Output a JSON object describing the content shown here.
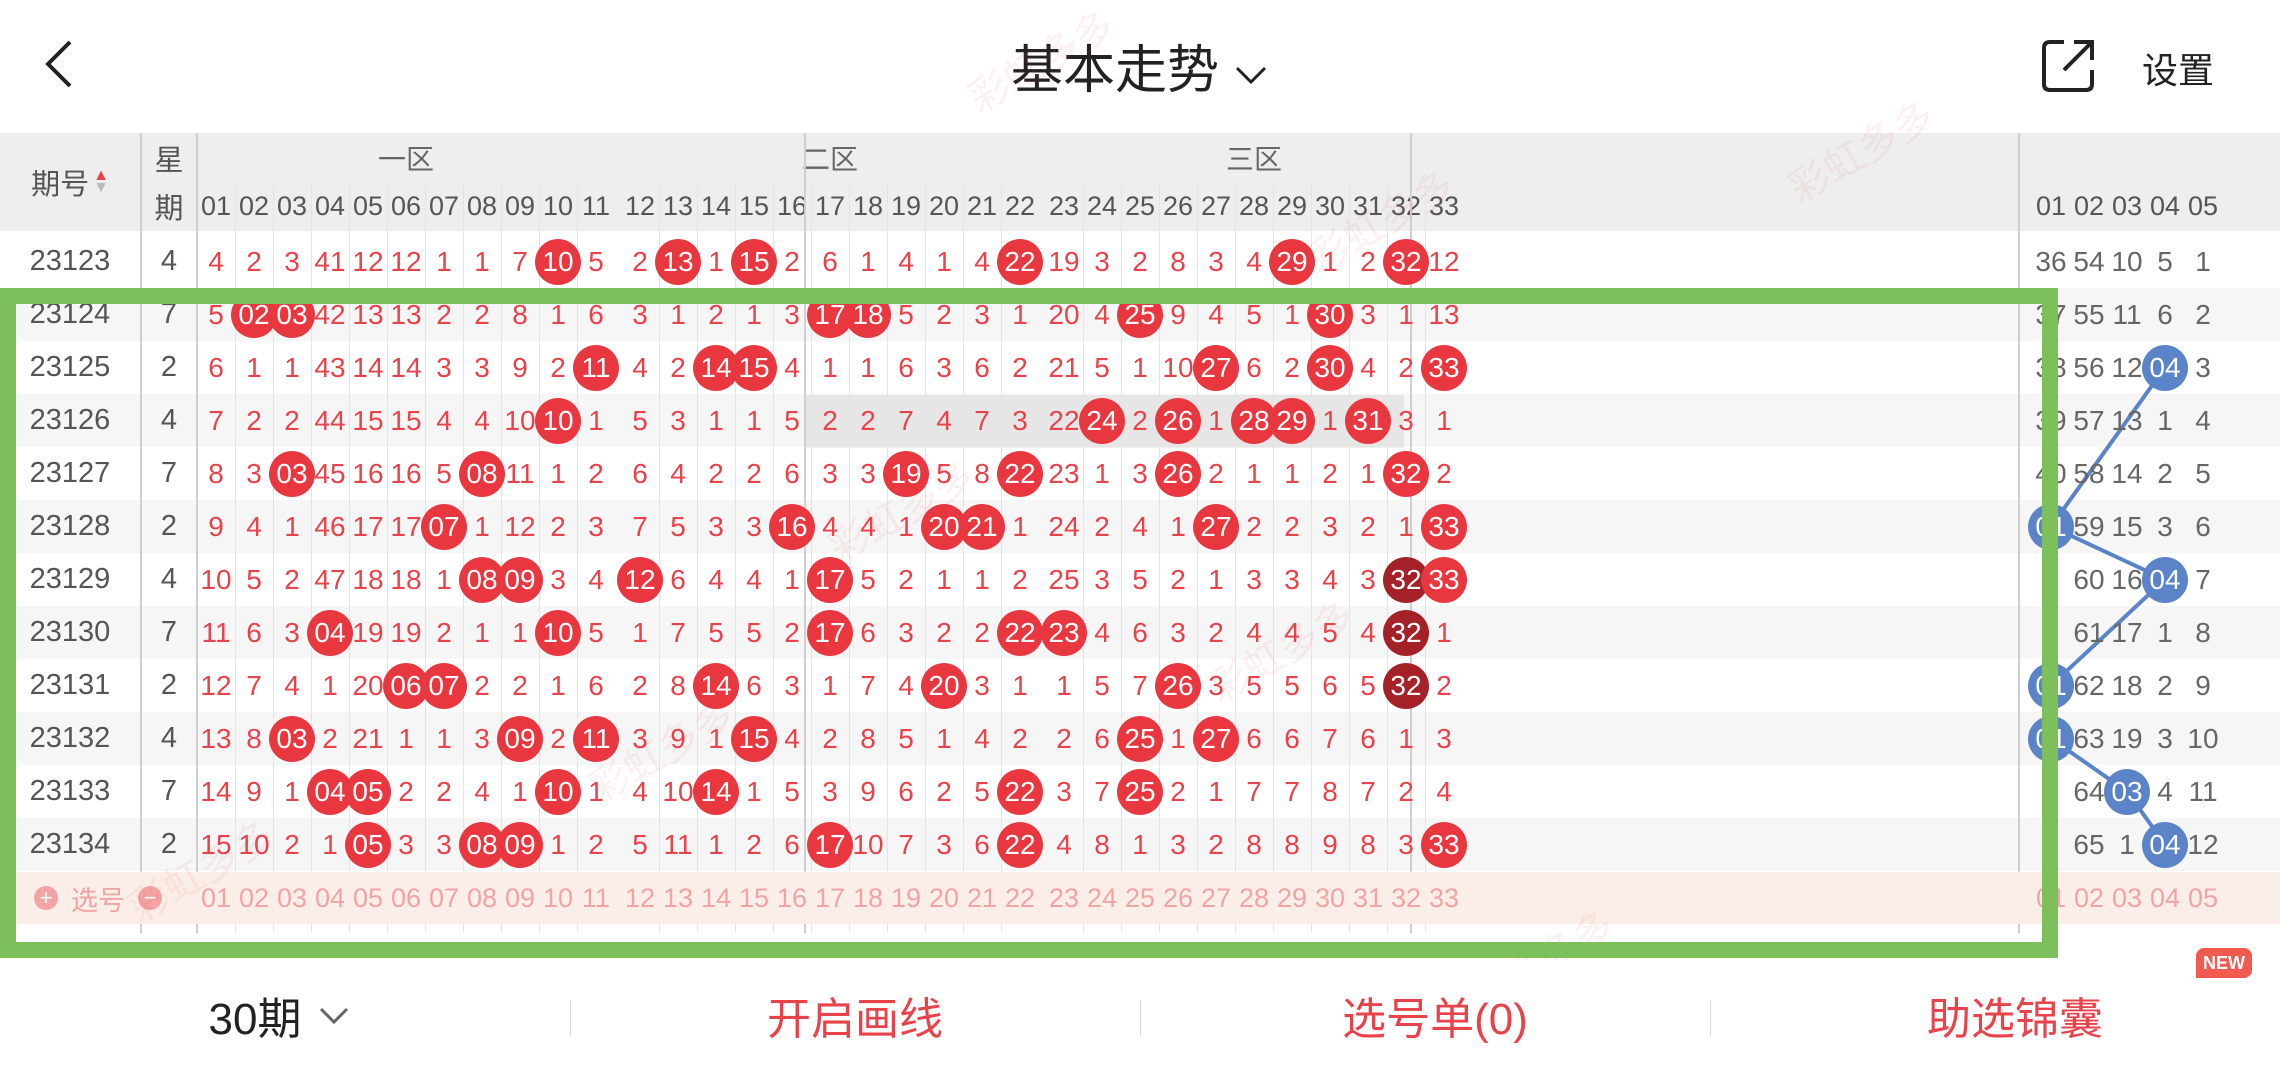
{
  "header": {
    "title": "基本走势",
    "settings_label": "设置"
  },
  "table": {
    "issue_header": "期号",
    "week_header_1": "星",
    "week_header_2": "期",
    "zones": [
      "一区",
      "二区",
      "三区"
    ],
    "front_numbers": [
      "01",
      "02",
      "03",
      "04",
      "05",
      "06",
      "07",
      "08",
      "09",
      "10",
      "11",
      "12",
      "13",
      "14",
      "15",
      "16",
      "17",
      "18",
      "19",
      "20",
      "21",
      "22",
      "23",
      "24",
      "25",
      "26",
      "27",
      "28",
      "29",
      "30",
      "31",
      "32",
      "33"
    ],
    "back_numbers": [
      "01",
      "02",
      "03",
      "04",
      "05"
    ],
    "rows": [
      {
        "issue": "23123",
        "week": "4",
        "cells": [
          "4",
          "2",
          "3",
          "41",
          "12",
          "12",
          "1",
          "1",
          "7",
          "10",
          "5",
          "2",
          "13",
          "1",
          "15",
          "2",
          "6",
          "1",
          "4",
          "1",
          "4",
          "22",
          "19",
          "3",
          "2",
          "8",
          "3",
          "4",
          "29",
          "1",
          "2",
          "32",
          "12"
        ],
        "balls": [
          9,
          12,
          14,
          21,
          28,
          31
        ],
        "back": [
          "36",
          "54",
          "10",
          "5",
          "1"
        ],
        "back_ball": null
      },
      {
        "issue": "23124",
        "week": "7",
        "cells": [
          "5",
          "02",
          "03",
          "42",
          "13",
          "13",
          "2",
          "2",
          "8",
          "1",
          "6",
          "3",
          "1",
          "2",
          "1",
          "3",
          "17",
          "18",
          "5",
          "2",
          "3",
          "1",
          "20",
          "4",
          "25",
          "9",
          "4",
          "5",
          "1",
          "30",
          "3",
          "1",
          "13"
        ],
        "balls": [
          1,
          2,
          16,
          17,
          24,
          29
        ],
        "back": [
          "37",
          "55",
          "11",
          "6",
          "2"
        ],
        "back_ball": null
      },
      {
        "issue": "23125",
        "week": "2",
        "cells": [
          "6",
          "1",
          "1",
          "43",
          "14",
          "14",
          "3",
          "3",
          "9",
          "2",
          "11",
          "4",
          "2",
          "14",
          "15",
          "4",
          "1",
          "1",
          "6",
          "3",
          "6",
          "2",
          "21",
          "5",
          "1",
          "10",
          "27",
          "6",
          "2",
          "30",
          "4",
          "2",
          "33"
        ],
        "balls": [
          10,
          13,
          14,
          26,
          29,
          32
        ],
        "back": [
          "38",
          "56",
          "12",
          "04",
          "3"
        ],
        "back_ball": 3
      },
      {
        "issue": "23126",
        "week": "4",
        "cells": [
          "7",
          "2",
          "2",
          "44",
          "15",
          "15",
          "4",
          "4",
          "10",
          "10",
          "1",
          "5",
          "3",
          "1",
          "1",
          "5",
          "2",
          "2",
          "7",
          "4",
          "7",
          "3",
          "22",
          "24",
          "2",
          "26",
          "1",
          "28",
          "29",
          "1",
          "31",
          "3",
          "1"
        ],
        "balls": [
          9,
          23,
          25,
          27,
          28,
          30
        ],
        "back": [
          "39",
          "57",
          "13",
          "1",
          "4"
        ],
        "back_ball": null
      },
      {
        "issue": "23127",
        "week": "7",
        "cells": [
          "8",
          "3",
          "03",
          "45",
          "16",
          "16",
          "5",
          "08",
          "11",
          "1",
          "2",
          "6",
          "4",
          "2",
          "2",
          "6",
          "3",
          "3",
          "19",
          "5",
          "8",
          "22",
          "23",
          "1",
          "3",
          "26",
          "2",
          "1",
          "1",
          "2",
          "1",
          "32",
          "2"
        ],
        "balls": [
          2,
          7,
          18,
          21,
          25,
          31
        ],
        "back": [
          "40",
          "58",
          "14",
          "2",
          "5"
        ],
        "back_ball": null
      },
      {
        "issue": "23128",
        "week": "2",
        "cells": [
          "9",
          "4",
          "1",
          "46",
          "17",
          "17",
          "07",
          "1",
          "12",
          "2",
          "3",
          "7",
          "5",
          "3",
          "3",
          "16",
          "4",
          "4",
          "1",
          "20",
          "21",
          "1",
          "24",
          "2",
          "4",
          "1",
          "27",
          "2",
          "2",
          "3",
          "2",
          "1",
          "33"
        ],
        "balls": [
          6,
          15,
          19,
          20,
          26,
          32
        ],
        "back": [
          "01",
          "59",
          "15",
          "3",
          "6"
        ],
        "back_ball": 0
      },
      {
        "issue": "23129",
        "week": "4",
        "cells": [
          "10",
          "5",
          "2",
          "47",
          "18",
          "18",
          "1",
          "08",
          "09",
          "3",
          "4",
          "12",
          "6",
          "4",
          "4",
          "1",
          "17",
          "5",
          "2",
          "1",
          "1",
          "2",
          "25",
          "3",
          "5",
          "2",
          "1",
          "3",
          "3",
          "4",
          "3",
          "32",
          "33"
        ],
        "balls": [
          7,
          8,
          11,
          16,
          31,
          32
        ],
        "back": [
          "1",
          "60",
          "16",
          "04",
          "7"
        ],
        "back_ball": 3,
        "dark": [
          31
        ]
      },
      {
        "issue": "23130",
        "week": "7",
        "cells": [
          "11",
          "6",
          "3",
          "04",
          "19",
          "19",
          "2",
          "1",
          "1",
          "10",
          "5",
          "1",
          "7",
          "5",
          "5",
          "2",
          "17",
          "6",
          "3",
          "2",
          "2",
          "22",
          "23",
          "4",
          "6",
          "3",
          "2",
          "4",
          "4",
          "5",
          "4",
          "32",
          "1"
        ],
        "balls": [
          3,
          9,
          16,
          21,
          22,
          31
        ],
        "back": [
          "2",
          "61",
          "17",
          "1",
          "8"
        ],
        "back_ball": null,
        "dark": [
          31
        ]
      },
      {
        "issue": "23131",
        "week": "2",
        "cells": [
          "12",
          "7",
          "4",
          "1",
          "20",
          "06",
          "07",
          "2",
          "2",
          "1",
          "6",
          "2",
          "8",
          "14",
          "6",
          "3",
          "1",
          "7",
          "4",
          "20",
          "3",
          "1",
          "1",
          "5",
          "7",
          "26",
          "3",
          "5",
          "5",
          "6",
          "5",
          "32",
          "2"
        ],
        "balls": [
          5,
          6,
          13,
          19,
          25,
          31
        ],
        "back": [
          "01",
          "62",
          "18",
          "2",
          "9"
        ],
        "back_ball": 0,
        "dark": [
          31
        ]
      },
      {
        "issue": "23132",
        "week": "4",
        "cells": [
          "13",
          "8",
          "03",
          "2",
          "21",
          "1",
          "1",
          "3",
          "09",
          "2",
          "11",
          "3",
          "9",
          "1",
          "15",
          "4",
          "2",
          "8",
          "5",
          "1",
          "4",
          "2",
          "2",
          "6",
          "25",
          "1",
          "27",
          "6",
          "6",
          "7",
          "6",
          "1",
          "3"
        ],
        "balls": [
          2,
          8,
          10,
          14,
          24,
          26
        ],
        "back": [
          "01",
          "63",
          "19",
          "3",
          "10"
        ],
        "back_ball": 0
      },
      {
        "issue": "23133",
        "week": "7",
        "cells": [
          "14",
          "9",
          "1",
          "04",
          "05",
          "2",
          "2",
          "4",
          "1",
          "10",
          "1",
          "4",
          "10",
          "14",
          "1",
          "5",
          "3",
          "9",
          "6",
          "2",
          "5",
          "22",
          "3",
          "7",
          "25",
          "2",
          "1",
          "7",
          "7",
          "8",
          "7",
          "2",
          "4"
        ],
        "balls": [
          3,
          4,
          9,
          13,
          21,
          24
        ],
        "back": [
          "2",
          "64",
          "03",
          "4",
          "11"
        ],
        "back_ball": 2
      },
      {
        "issue": "23134",
        "week": "2",
        "cells": [
          "15",
          "10",
          "2",
          "1",
          "05",
          "3",
          "3",
          "08",
          "09",
          "1",
          "2",
          "5",
          "11",
          "1",
          "2",
          "6",
          "17",
          "10",
          "7",
          "3",
          "6",
          "22",
          "4",
          "8",
          "1",
          "3",
          "2",
          "8",
          "8",
          "9",
          "8",
          "3",
          "33"
        ],
        "balls": [
          4,
          7,
          8,
          16,
          21,
          32
        ],
        "back": [
          "3",
          "65",
          "1",
          "04",
          "12"
        ],
        "back_ball": 3
      }
    ],
    "select_label": "选号"
  },
  "bottom": {
    "period_label": "30期",
    "draw_line_label": "开启画线",
    "ticket_label": "选号单(0)",
    "helper_label": "助选锦囊",
    "new_badge": "NEW"
  },
  "watermark": "彩虹多多",
  "colors": {
    "red_ball": "#e8373f",
    "dark_ball": "#a52128",
    "blue_ball": "#5b84c8",
    "highlight_frame": "#7dbf5b",
    "accent": "#e8424b"
  }
}
